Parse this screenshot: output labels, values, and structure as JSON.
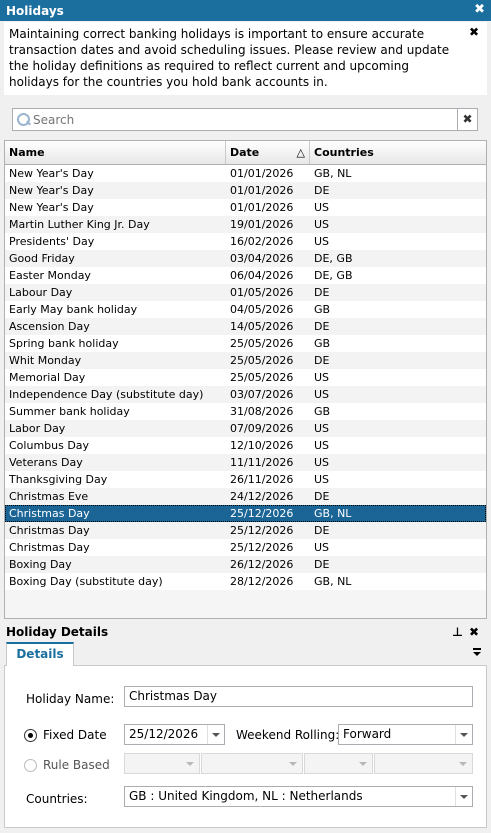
{
  "panel": {
    "title": "Holidays"
  },
  "info": {
    "text": "Maintaining correct banking holidays is important to ensure accurate transaction dates and avoid scheduling issues. Please review and update the holiday definitions as required to reflect current and upcoming holidays for the countries you hold bank accounts in."
  },
  "search": {
    "placeholder": "Search",
    "value": ""
  },
  "grid": {
    "headers": {
      "name": "Name",
      "date": "Date",
      "countries": "Countries",
      "sort_indicator": "△"
    },
    "rows": [
      {
        "name": "New Year's Day",
        "date": "01/01/2026",
        "countries": "GB, NL"
      },
      {
        "name": "New Year's Day",
        "date": "01/01/2026",
        "countries": "DE"
      },
      {
        "name": "New Year's Day",
        "date": "01/01/2026",
        "countries": "US"
      },
      {
        "name": "Martin Luther King Jr. Day",
        "date": "19/01/2026",
        "countries": "US"
      },
      {
        "name": "Presidents' Day",
        "date": "16/02/2026",
        "countries": "US"
      },
      {
        "name": "Good Friday",
        "date": "03/04/2026",
        "countries": "DE, GB"
      },
      {
        "name": "Easter Monday",
        "date": "06/04/2026",
        "countries": "DE, GB"
      },
      {
        "name": "Labour Day",
        "date": "01/05/2026",
        "countries": "DE"
      },
      {
        "name": "Early May bank holiday",
        "date": "04/05/2026",
        "countries": "GB"
      },
      {
        "name": "Ascension Day",
        "date": "14/05/2026",
        "countries": "DE"
      },
      {
        "name": "Spring bank holiday",
        "date": "25/05/2026",
        "countries": "GB"
      },
      {
        "name": "Whit Monday",
        "date": "25/05/2026",
        "countries": "DE"
      },
      {
        "name": "Memorial Day",
        "date": "25/05/2026",
        "countries": "US"
      },
      {
        "name": "Independence Day (substitute day)",
        "date": "03/07/2026",
        "countries": "US"
      },
      {
        "name": "Summer bank holiday",
        "date": "31/08/2026",
        "countries": "GB"
      },
      {
        "name": "Labor Day",
        "date": "07/09/2026",
        "countries": "US"
      },
      {
        "name": "Columbus Day",
        "date": "12/10/2026",
        "countries": "US"
      },
      {
        "name": "Veterans Day",
        "date": "11/11/2026",
        "countries": "US"
      },
      {
        "name": "Thanksgiving Day",
        "date": "26/11/2026",
        "countries": "US"
      },
      {
        "name": "Christmas Eve",
        "date": "24/12/2026",
        "countries": "DE"
      },
      {
        "name": "Christmas Day",
        "date": "25/12/2026",
        "countries": "GB, NL",
        "selected": true
      },
      {
        "name": "Christmas Day",
        "date": "25/12/2026",
        "countries": "DE"
      },
      {
        "name": "Christmas Day",
        "date": "25/12/2026",
        "countries": "US"
      },
      {
        "name": "Boxing Day",
        "date": "26/12/2026",
        "countries": "DE"
      },
      {
        "name": "Boxing Day (substitute day)",
        "date": "28/12/2026",
        "countries": "GB, NL"
      }
    ]
  },
  "details_panel": {
    "title": "Holiday Details",
    "tab_label": "Details"
  },
  "form": {
    "holiday_name_label": "Holiday Name:",
    "holiday_name_value": "Christmas Day",
    "fixed_date_label": "Fixed Date",
    "fixed_date_value": "25/12/2026",
    "weekend_rolling_label": "Weekend Rolling:",
    "weekend_rolling_value": "Forward",
    "rule_based_label": "Rule Based",
    "countries_label": "Countries:",
    "countries_value": "GB : United Kingdom, NL : Netherlands"
  },
  "colors": {
    "accent": "#1b6f9f",
    "selection": "#1a6496"
  }
}
